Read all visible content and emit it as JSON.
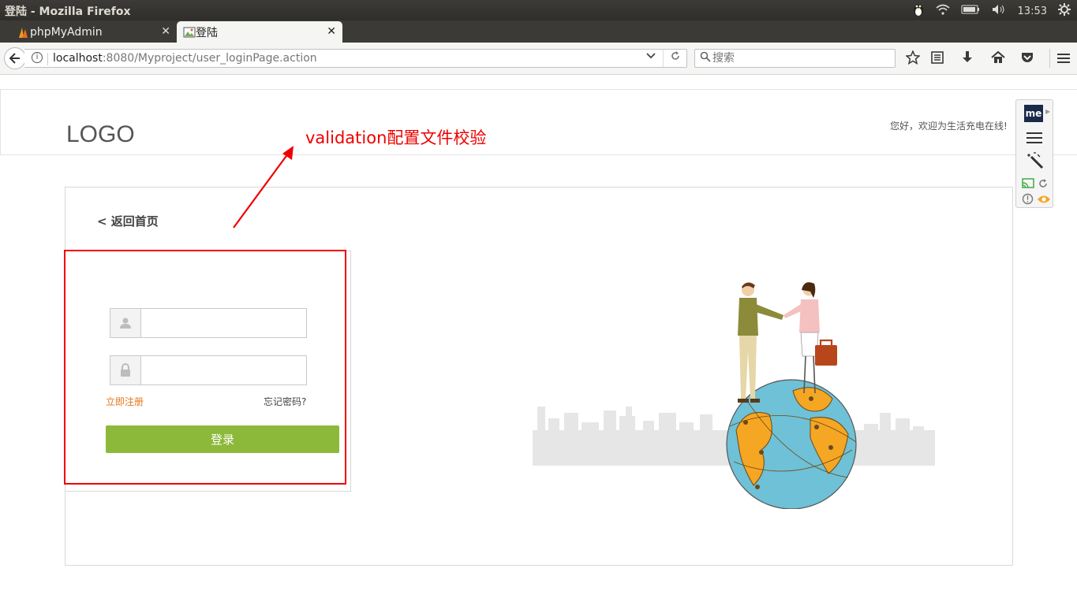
{
  "os": {
    "window_title": "登陆 - Mozilla Firefox",
    "clock": "13:53"
  },
  "browser": {
    "tabs": [
      {
        "label": "phpMyAdmin",
        "active": false
      },
      {
        "label": "登陆",
        "active": true
      }
    ],
    "url_host": "localhost",
    "url_rest": ":8080/Myproject/user_loginPage.action",
    "search_placeholder": "搜索"
  },
  "page": {
    "logo": "LOGO",
    "welcome": "您好，欢迎为生活充电在线!",
    "back_link": "< 返回首页",
    "login": {
      "username_value": "",
      "password_value": "",
      "register_link": "立即注册",
      "forgot_link": "忘记密码?",
      "submit_label": "登录"
    },
    "extension": {
      "badge": "me"
    }
  },
  "annotation": {
    "text": "validation配置文件校验",
    "color": "#e00000"
  },
  "colors": {
    "accent_green": "#8db93a",
    "link_orange": "#e8751a"
  }
}
